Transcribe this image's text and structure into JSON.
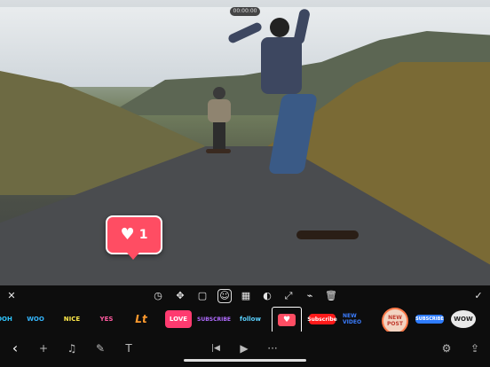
{
  "timecode": "00:00:00",
  "preview": {
    "sticker": {
      "icon": "heart-icon",
      "glyph": "♥",
      "count": "1",
      "color": "#ff4d63"
    }
  },
  "toolbar": {
    "close_glyph": "✕",
    "done_glyph": "✓",
    "tools": [
      {
        "name": "timer-icon",
        "glyph": "◷"
      },
      {
        "name": "move-icon",
        "glyph": "✥"
      },
      {
        "name": "crop-icon",
        "glyph": "▢"
      },
      {
        "name": "emoji-icon",
        "glyph": "☺"
      },
      {
        "name": "checkerboard-icon",
        "glyph": "▦"
      },
      {
        "name": "toggle-icon",
        "glyph": "◐"
      },
      {
        "name": "transform-icon",
        "glyph": "⤢"
      },
      {
        "name": "tag-icon",
        "glyph": "⌁"
      },
      {
        "name": "trash-icon",
        "glyph": "🗑"
      }
    ]
  },
  "stickers": [
    {
      "name": "sticker-ooh",
      "text": "OOH",
      "bg": "#1b0f2b",
      "fg": "#30c6ff"
    },
    {
      "name": "sticker-woo",
      "text": "WOO",
      "bg": "#0d0d0d",
      "fg": "#35b8ff"
    },
    {
      "name": "sticker-nice",
      "text": "NICE",
      "bg": "#0d0d0d",
      "fg": "#ffe94a"
    },
    {
      "name": "sticker-yes",
      "text": "YES",
      "bg": "#0d0d0d",
      "fg": "#ff5aa0"
    },
    {
      "name": "sticker-lol",
      "text": "Lt",
      "bg": "#0d0d0d",
      "fg": "#ff9a2e"
    },
    {
      "name": "sticker-love",
      "text": "LOVE",
      "bg": "#ff3b70",
      "fg": "#fff"
    },
    {
      "name": "sticker-subscribe",
      "text": "SUBSCRIBE",
      "bg": "#0d0d0d",
      "fg": "#b06bff"
    },
    {
      "name": "sticker-follow",
      "text": "follow",
      "bg": "#0d0d0d",
      "fg": "#5ad1ff"
    },
    {
      "name": "sticker-like",
      "text": "♥",
      "bg": "#ff4d63",
      "fg": "#fff",
      "selected": true
    },
    {
      "name": "sticker-youtube",
      "text": "Subscribe",
      "bg": "#ff1a1a",
      "fg": "#fff"
    },
    {
      "name": "sticker-newvideo",
      "text": "NEW VIDEO",
      "bg": "#0d0d0d",
      "fg": "#3b7dff"
    },
    {
      "name": "sticker-newpost",
      "text": "NEW POST",
      "bg": "#f2d4c2",
      "fg": "#c0392b"
    },
    {
      "name": "sticker-subscribe2",
      "text": "SUBSCRIBE",
      "bg": "#2e7cff",
      "fg": "#fff"
    },
    {
      "name": "sticker-burst",
      "text": "WOW",
      "bg": "#e9e9e9",
      "fg": "#222"
    }
  ],
  "bottom": {
    "back_glyph": "‹",
    "add_glyph": "+",
    "music_glyph": "♫",
    "pen_glyph": "✎",
    "text_glyph": "T",
    "prev_glyph": "|◀",
    "play_glyph": "▶",
    "more_glyph": "···",
    "settings_glyph": "⚙",
    "share_glyph": "⇪"
  }
}
